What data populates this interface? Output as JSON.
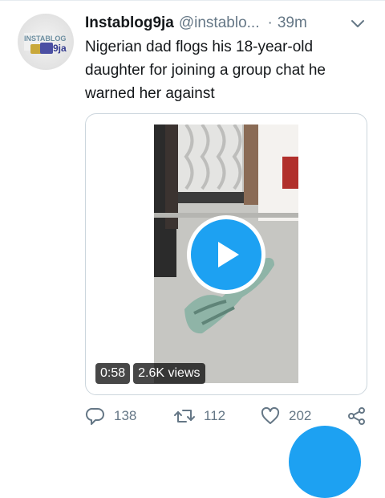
{
  "tweet": {
    "author_name": "Instablog9ja",
    "handle": "@instablo...",
    "separator": "·",
    "timestamp": "39m",
    "text": "Nigerian dad flogs his 18-year-old daughter for joining a group chat he warned her against",
    "avatar_logo_text_top": "INSTABLOG",
    "avatar_logo_text_bottom": "9ja"
  },
  "media": {
    "duration": "0:58",
    "views": "2.6K views"
  },
  "actions": {
    "reply_count": "138",
    "retweet_count": "112",
    "like_count": "202"
  },
  "colors": {
    "accent": "#1da1f2",
    "secondary_text": "#657786",
    "border": "#ccd6dd"
  },
  "icons": {
    "menu": "chevron-down-icon",
    "reply": "reply-icon",
    "retweet": "retweet-icon",
    "like": "heart-icon",
    "share": "share-icon",
    "play": "play-icon"
  }
}
